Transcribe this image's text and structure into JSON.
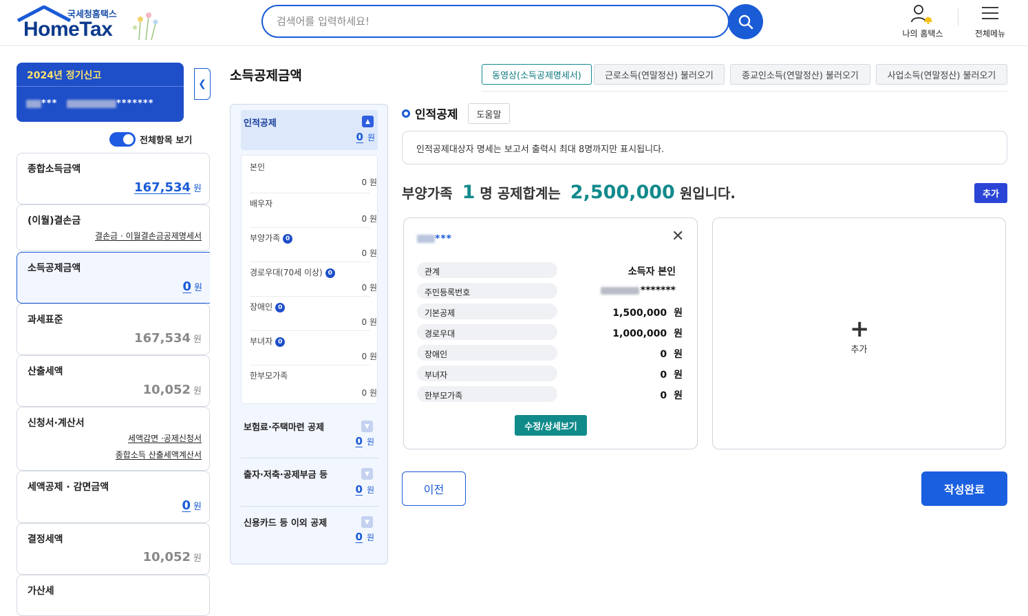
{
  "header": {
    "logo_sub": "국세청홈택스",
    "logo_main": "HomeTax",
    "search_placeholder": "검색어를 입력하세요!",
    "my_hometax": "나의 홈택스",
    "all_menu": "전체메뉴"
  },
  "sidebar": {
    "user_title": "2024년 정기신고",
    "user_name_mask": "***",
    "user_id_mask": "*******",
    "toggle_label": "전체항목 보기",
    "cards": [
      {
        "title": "종합소득금액",
        "value": "167,534",
        "unit": "원"
      },
      {
        "title": "(이월)결손금",
        "link": "결손금 · 이월결손금공제명세서"
      },
      {
        "title": "소득공제금액",
        "value": "0",
        "unit": "원"
      },
      {
        "title": "과세표준",
        "value": "167,534",
        "unit": "원"
      },
      {
        "title": "산출세액",
        "value": "10,052",
        "unit": "원"
      },
      {
        "title": "신청서·계산서",
        "link1": "세액감면 ·공제신청서",
        "link2": "종합소득 산출세액계산서"
      },
      {
        "title": "세액공제 · 감면금액",
        "value": "0",
        "unit": "원"
      },
      {
        "title": "결정세액",
        "value": "10,052",
        "unit": "원"
      },
      {
        "title": "가산세"
      }
    ]
  },
  "main": {
    "title": "소득공제금액",
    "top_buttons": [
      "동영상(소득공제명세서)",
      "근로소득(연말정산) 불러오기",
      "종교인소득(연말정산) 불러오기",
      "사업소득(연말정산) 불러오기"
    ]
  },
  "categories": {
    "personal": {
      "title": "인적공제",
      "value": "0",
      "unit": "원"
    },
    "sub_items": [
      {
        "name": "본인",
        "amount": "0 원"
      },
      {
        "name": "배우자",
        "amount": "0 원"
      },
      {
        "name": "부양가족",
        "badge": "0",
        "amount": "0 원"
      },
      {
        "name": "경로우대(70세 이상)",
        "badge": "0",
        "amount": "0 원"
      },
      {
        "name": "장애인",
        "badge": "0",
        "amount": "0 원"
      },
      {
        "name": "부녀자",
        "badge": "0",
        "amount": "0 원"
      },
      {
        "name": "한부모가족",
        "amount": "0 원"
      }
    ],
    "others": [
      {
        "title": "보험료·주택마련 공제",
        "value": "0",
        "unit": "원"
      },
      {
        "title": "출자·저축·공제부금 등",
        "value": "0",
        "unit": "원"
      },
      {
        "title": "신용카드 등 이외 공제",
        "value": "0",
        "unit": "원"
      }
    ]
  },
  "section": {
    "title": "인적공제",
    "help": "도움말",
    "notice": "인적공제대상자 명세는 보고서 출력시 최대 8명까지만 표시됩니다.",
    "summary_pre": "부양가족",
    "summary_count": "1",
    "summary_mid": "명 공제합계는",
    "summary_total": "2,500,000",
    "summary_post": "원입니다.",
    "add_button": "추가"
  },
  "person_card": {
    "name_mask": "***",
    "rows": [
      {
        "label": "관계",
        "value": "소득자 본인",
        "unit": ""
      },
      {
        "label": "주민등록번호",
        "value": "*******",
        "unit": ""
      },
      {
        "label": "기본공제",
        "value": "1,500,000",
        "unit": "원"
      },
      {
        "label": "경로우대",
        "value": "1,000,000",
        "unit": "원"
      },
      {
        "label": "장애인",
        "value": "0",
        "unit": "원"
      },
      {
        "label": "부녀자",
        "value": "0",
        "unit": "원"
      },
      {
        "label": "한부모가족",
        "value": "0",
        "unit": "원"
      }
    ],
    "edit_button": "수정/상세보기"
  },
  "add_card": {
    "label": "추가"
  },
  "footer": {
    "prev": "이전",
    "done": "작성완료"
  }
}
